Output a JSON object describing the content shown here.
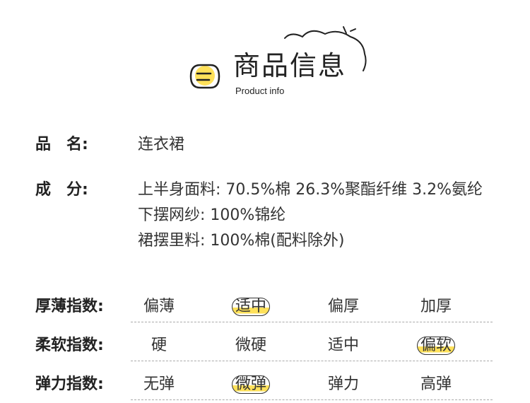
{
  "header": {
    "title": "商品信息",
    "subtitle": "Product info"
  },
  "info": {
    "name_label": "品　名:",
    "name_value": "连衣裙",
    "composition_label": "成　分:",
    "composition_lines": [
      "上半身面料: 70.5%棉 26.3%聚酯纤维 3.2%氨纶",
      "下摆网纱: 100%锦纶",
      "裙摆里料: 100%棉(配料除外)"
    ]
  },
  "indices": [
    {
      "label": "厚薄指数:",
      "options": [
        "偏薄",
        "适中",
        "偏厚",
        "加厚"
      ],
      "selected_index": 1
    },
    {
      "label": "柔软指数:",
      "options": [
        "硬",
        "微硬",
        "适中",
        "偏软"
      ],
      "selected_index": 3
    },
    {
      "label": "弹力指数:",
      "options": [
        "无弹",
        "微弹",
        "弹力",
        "高弹"
      ],
      "selected_index": 1
    }
  ],
  "colors": {
    "accent": "#ffe15a",
    "text": "#333333"
  }
}
